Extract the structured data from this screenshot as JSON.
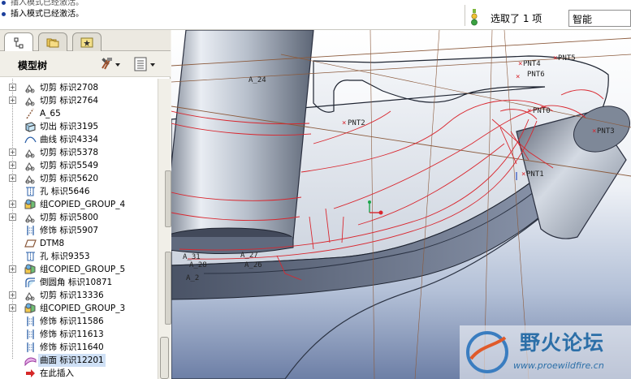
{
  "messages": [
    "插入模式已经激活。",
    "插入模式已经激活。"
  ],
  "status": {
    "selection_text": "选取了 1 项",
    "filter_value": "智能"
  },
  "model_tree": {
    "title": "模型树",
    "items": [
      {
        "label": "切剪 标识2708",
        "icon": "cut-icon",
        "expandable": true
      },
      {
        "label": "切剪 标识2764",
        "icon": "cut-icon",
        "expandable": true
      },
      {
        "label": "A_65",
        "icon": "datum-axis-icon",
        "expandable": false
      },
      {
        "label": "切出 标识3195",
        "icon": "extrude-cut-icon",
        "expandable": false
      },
      {
        "label": "曲线 标识4334",
        "icon": "curve-icon",
        "expandable": false
      },
      {
        "label": "切剪 标识5378",
        "icon": "cut-icon",
        "expandable": true
      },
      {
        "label": "切剪 标识5549",
        "icon": "cut-icon",
        "expandable": true
      },
      {
        "label": "切剪 标识5620",
        "icon": "cut-icon",
        "expandable": true
      },
      {
        "label": "孔 标识5646",
        "icon": "hole-icon",
        "expandable": false
      },
      {
        "label": "组COPIED_GROUP_4",
        "icon": "group-icon",
        "expandable": true
      },
      {
        "label": "切剪 标识5800",
        "icon": "cut-icon",
        "expandable": true
      },
      {
        "label": "修饰 标识5907",
        "icon": "cosmetic-icon",
        "expandable": false
      },
      {
        "label": "DTM8",
        "icon": "datum-plane-icon",
        "expandable": false
      },
      {
        "label": "孔 标识9353",
        "icon": "hole-icon",
        "expandable": false
      },
      {
        "label": "组COPIED_GROUP_5",
        "icon": "group-icon",
        "expandable": true
      },
      {
        "label": "倒圆角 标识10871",
        "icon": "round-icon",
        "expandable": false
      },
      {
        "label": "切剪 标识13336",
        "icon": "cut-icon",
        "expandable": true
      },
      {
        "label": "组COPIED_GROUP_3",
        "icon": "group-icon",
        "expandable": true
      },
      {
        "label": "修饰 标识11586",
        "icon": "cosmetic-icon",
        "expandable": false
      },
      {
        "label": "修饰 标识11613",
        "icon": "cosmetic-icon",
        "expandable": false
      },
      {
        "label": "修饰 标识11640",
        "icon": "cosmetic-icon",
        "expandable": false
      },
      {
        "label": "曲面 标识12201",
        "icon": "surface-icon",
        "expandable": false,
        "selected": true
      },
      {
        "label": "在此插入",
        "icon": "insert-here-icon",
        "expandable": false
      }
    ]
  },
  "viewport": {
    "labels": {
      "a24": "A_24",
      "pnt2": "PNT2",
      "pnt4": "PNT4",
      "pnt5": "PNT5",
      "pnt6": "PNT6",
      "pnt0": "PNT0",
      "pnt3": "PNT3",
      "pnt1": "PNT1",
      "a31": "A_31",
      "a28": "A_28",
      "a27": "A_27",
      "a26": "A_26",
      "a2": "A_2"
    }
  },
  "watermark": {
    "title": "野火论坛",
    "url": "www.proewildfire.cn"
  },
  "colors": {
    "selection": "#cfe0f5",
    "edge_red": "#d9262e",
    "datum_brown": "#8b5a3c"
  }
}
